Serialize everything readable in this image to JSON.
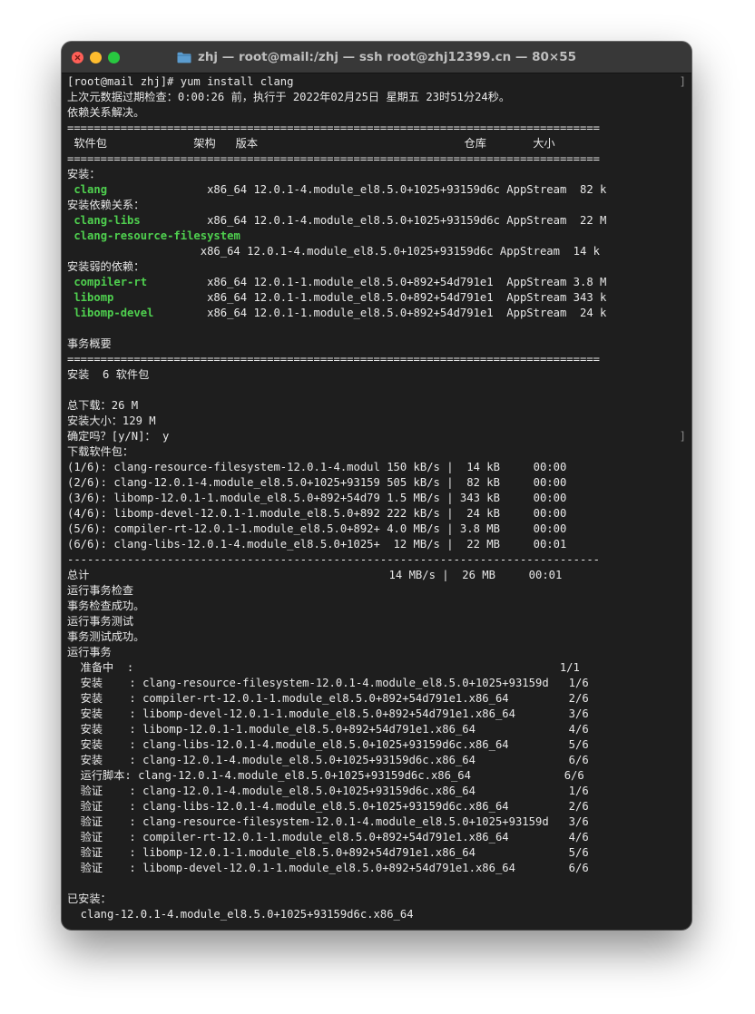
{
  "window": {
    "title": "zhj — root@mail:/zhj — ssh root@zhj12399.cn — 80×55"
  },
  "icons": {
    "close": "close-icon",
    "minimize": "minimize-icon",
    "maximize": "maximize-icon",
    "folder": "folder-icon"
  },
  "colors": {
    "package_name": "#4fd04f",
    "background": "#1e1e1e",
    "text": "#e8e8e8"
  },
  "terminal": {
    "lines": [
      {
        "text": "[root@mail zhj]# yum install clang",
        "name": "command-line"
      },
      {
        "text": "上次元数据过期检查：0:00:26 前，执行于 2022年02月25日 星期五 23时51分24秒。",
        "name": "metadata-line"
      },
      {
        "text": "依赖关系解决。",
        "name": "deps-resolved-line"
      },
      {
        "text": "================================================================================",
        "name": "separator-line"
      },
      {
        "text": " 软件包             架构   版本                               仓库       大小",
        "name": "table-header-line"
      },
      {
        "text": "================================================================================",
        "name": "separator-line"
      },
      {
        "text": "安装：",
        "name": "section-install"
      },
      {
        "pkg": "clang",
        "rest": "               x86_64 12.0.1-4.module_el8.5.0+1025+93159d6c AppStream  82 k",
        "name": "package-row"
      },
      {
        "text": "安装依赖关系：",
        "name": "section-deps"
      },
      {
        "pkg": "clang-libs",
        "rest": "          x86_64 12.0.1-4.module_el8.5.0+1025+93159d6c AppStream  22 M",
        "name": "package-row"
      },
      {
        "pkg": "clang-resource-filesystem",
        "rest": "",
        "name": "package-row"
      },
      {
        "text": "                    x86_64 12.0.1-4.module_el8.5.0+1025+93159d6c AppStream  14 k",
        "name": "package-row-cont"
      },
      {
        "text": "安装弱的依赖：",
        "name": "section-weak-deps"
      },
      {
        "pkg": "compiler-rt",
        "rest": "         x86_64 12.0.1-1.module_el8.5.0+892+54d791e1  AppStream 3.8 M",
        "name": "package-row"
      },
      {
        "pkg": "libomp",
        "rest": "              x86_64 12.0.1-1.module_el8.5.0+892+54d791e1  AppStream 343 k",
        "name": "package-row"
      },
      {
        "pkg": "libomp-devel",
        "rest": "        x86_64 12.0.1-1.module_el8.5.0+892+54d791e1  AppStream  24 k",
        "name": "package-row"
      },
      {
        "text": "",
        "name": "blank-line"
      },
      {
        "text": "事务概要",
        "name": "transaction-summary"
      },
      {
        "text": "================================================================================",
        "name": "separator-line"
      },
      {
        "text": "安装  6 软件包",
        "name": "install-count"
      },
      {
        "text": "",
        "name": "blank-line"
      },
      {
        "text": "总下载：26 M",
        "name": "total-download"
      },
      {
        "text": "安装大小：129 M",
        "name": "install-size"
      },
      {
        "text": "确定吗？[y/N]： y",
        "name": "confirm-prompt",
        "bracket": "]"
      },
      {
        "text": "下载软件包：",
        "name": "download-heading"
      },
      {
        "text": "(1/6): clang-resource-filesystem-12.0.1-4.modul 150 kB/s |  14 kB     00:00",
        "name": "download-row"
      },
      {
        "text": "(2/6): clang-12.0.1-4.module_el8.5.0+1025+93159 505 kB/s |  82 kB     00:00",
        "name": "download-row"
      },
      {
        "text": "(3/6): libomp-12.0.1-1.module_el8.5.0+892+54d79 1.5 MB/s | 343 kB     00:00",
        "name": "download-row"
      },
      {
        "text": "(4/6): libomp-devel-12.0.1-1.module_el8.5.0+892 222 kB/s |  24 kB     00:00",
        "name": "download-row"
      },
      {
        "text": "(5/6): compiler-rt-12.0.1-1.module_el8.5.0+892+ 4.0 MB/s | 3.8 MB     00:00",
        "name": "download-row"
      },
      {
        "text": "(6/6): clang-libs-12.0.1-4.module_el8.5.0+1025+  12 MB/s |  22 MB     00:01",
        "name": "download-row"
      },
      {
        "text": "--------------------------------------------------------------------------------",
        "name": "dash-separator"
      },
      {
        "text": "总计                                             14 MB/s |  26 MB     00:01",
        "name": "download-total"
      },
      {
        "text": "运行事务检查",
        "name": "status-line"
      },
      {
        "text": "事务检查成功。",
        "name": "status-line"
      },
      {
        "text": "运行事务测试",
        "name": "status-line"
      },
      {
        "text": "事务测试成功。",
        "name": "status-line"
      },
      {
        "text": "运行事务",
        "name": "status-line"
      },
      {
        "text": "  准备中  :                                                                1/1",
        "name": "progress-row"
      },
      {
        "text": "  安装    : clang-resource-filesystem-12.0.1-4.module_el8.5.0+1025+93159d   1/6",
        "name": "progress-row"
      },
      {
        "text": "  安装    : compiler-rt-12.0.1-1.module_el8.5.0+892+54d791e1.x86_64         2/6",
        "name": "progress-row"
      },
      {
        "text": "  安装    : libomp-devel-12.0.1-1.module_el8.5.0+892+54d791e1.x86_64        3/6",
        "name": "progress-row"
      },
      {
        "text": "  安装    : libomp-12.0.1-1.module_el8.5.0+892+54d791e1.x86_64              4/6",
        "name": "progress-row"
      },
      {
        "text": "  安装    : clang-libs-12.0.1-4.module_el8.5.0+1025+93159d6c.x86_64         5/6",
        "name": "progress-row"
      },
      {
        "text": "  安装    : clang-12.0.1-4.module_el8.5.0+1025+93159d6c.x86_64              6/6",
        "name": "progress-row"
      },
      {
        "text": "  运行脚本: clang-12.0.1-4.module_el8.5.0+1025+93159d6c.x86_64              6/6",
        "name": "progress-row"
      },
      {
        "text": "  验证    : clang-12.0.1-4.module_el8.5.0+1025+93159d6c.x86_64              1/6",
        "name": "progress-row"
      },
      {
        "text": "  验证    : clang-libs-12.0.1-4.module_el8.5.0+1025+93159d6c.x86_64         2/6",
        "name": "progress-row"
      },
      {
        "text": "  验证    : clang-resource-filesystem-12.0.1-4.module_el8.5.0+1025+93159d   3/6",
        "name": "progress-row"
      },
      {
        "text": "  验证    : compiler-rt-12.0.1-1.module_el8.5.0+892+54d791e1.x86_64         4/6",
        "name": "progress-row"
      },
      {
        "text": "  验证    : libomp-12.0.1-1.module_el8.5.0+892+54d791e1.x86_64              5/6",
        "name": "progress-row"
      },
      {
        "text": "  验证    : libomp-devel-12.0.1-1.module_el8.5.0+892+54d791e1.x86_64        6/6",
        "name": "progress-row"
      },
      {
        "text": "",
        "name": "blank-line"
      },
      {
        "text": "已安装：",
        "name": "installed-heading"
      },
      {
        "text": "  clang-12.0.1-4.module_el8.5.0+1025+93159d6c.x86_64",
        "name": "installed-item"
      }
    ],
    "first_line_bracket": "]"
  }
}
